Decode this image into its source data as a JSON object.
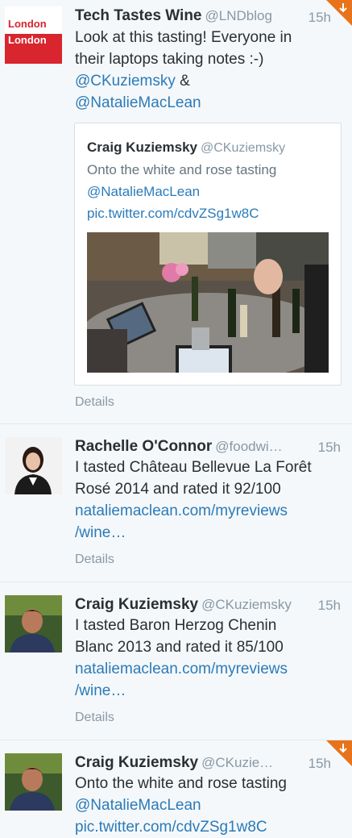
{
  "tweets": [
    {
      "name": "Tech Tastes Wine",
      "handle": "@LNDblog",
      "time": "15h",
      "text_line1": "Look at this tasting! Everyone in",
      "text_line2": "their laptops taking notes :-)",
      "mention1": "@CKuziemsky",
      "amp": " &",
      "mention2": "@NatalieMacLean",
      "details": "Details",
      "avatar_text1": "London",
      "avatar_text2": "London",
      "quote": {
        "name": "Craig Kuziemsky",
        "handle": "@CKuziemsky",
        "text": "Onto the white and rose tasting",
        "mention": "@NatalieMacLean",
        "link": "pic.twitter.com/cdvZSg1w8C"
      }
    },
    {
      "name": "Rachelle O'Connor",
      "handle": "@foodwi…",
      "time": "15h",
      "text_line1": "I tasted Château Bellevue La Forêt",
      "text_line2": "Rosé 2014 and rated it 92/100",
      "link1": "nataliemaclean.com/myreviews",
      "link2": "/wine…",
      "details": "Details"
    },
    {
      "name": "Craig Kuziemsky",
      "handle": "@CKuziemsky",
      "time": "15h",
      "text_line1": "I tasted Baron Herzog Chenin",
      "text_line2": "Blanc 2013 and rated it 85/100",
      "link1": "nataliemaclean.com/myreviews",
      "link2": "/wine…",
      "details": "Details"
    },
    {
      "name": "Craig Kuziemsky",
      "handle": "@CKuzie…",
      "time": "15h",
      "text_line1": "Onto the white and rose tasting",
      "mention": "@NatalieMacLean",
      "link": "pic.twitter.com/cdvZSg1w8C"
    }
  ]
}
